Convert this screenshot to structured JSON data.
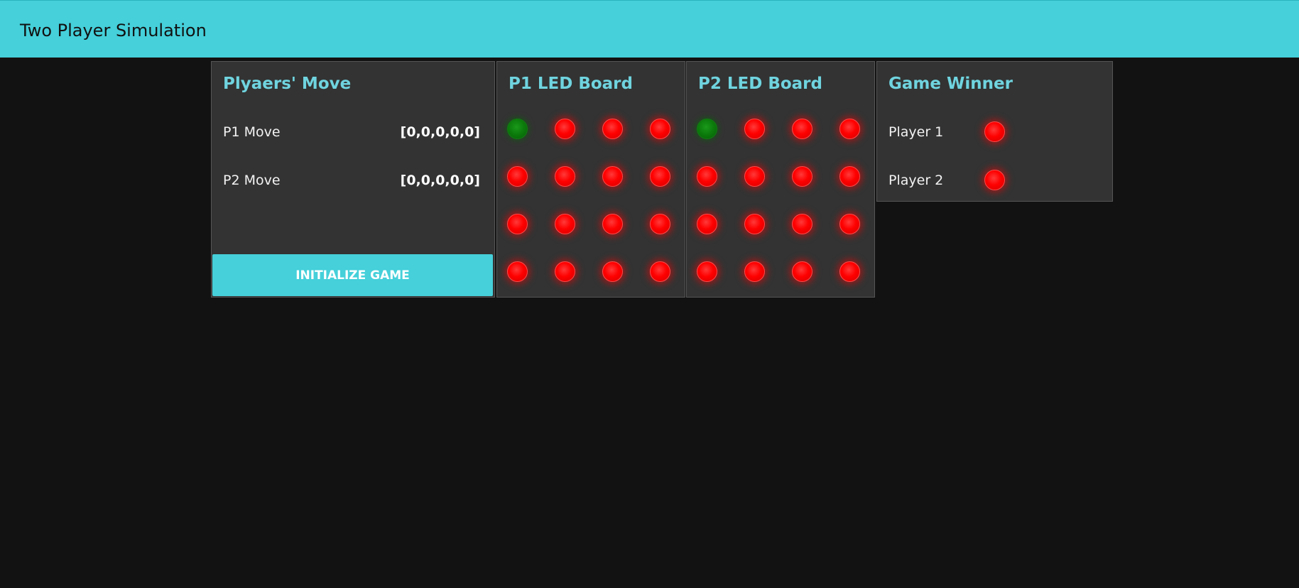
{
  "header": {
    "title": "Two Player Simulation"
  },
  "moves_card": {
    "title": "Plyaers' Move",
    "rows": [
      {
        "label": "P1 Move",
        "value": "[0,0,0,0,0]"
      },
      {
        "label": "P2 Move",
        "value": "[0,0,0,0,0]"
      }
    ],
    "init_button_label": "INITIALIZE GAME"
  },
  "p1_board": {
    "title": "P1 LED Board",
    "leds": [
      [
        "green",
        "red",
        "red",
        "red"
      ],
      [
        "red",
        "red",
        "red",
        "red"
      ],
      [
        "red",
        "red",
        "red",
        "red"
      ],
      [
        "red",
        "red",
        "red",
        "red"
      ]
    ]
  },
  "p2_board": {
    "title": "P2 LED Board",
    "leds": [
      [
        "green",
        "red",
        "red",
        "red"
      ],
      [
        "red",
        "red",
        "red",
        "red"
      ],
      [
        "red",
        "red",
        "red",
        "red"
      ],
      [
        "red",
        "red",
        "red",
        "red"
      ]
    ]
  },
  "winner_card": {
    "title": "Game Winner",
    "rows": [
      {
        "label": "Player 1",
        "led": "red"
      },
      {
        "label": "Player 2",
        "led": "red"
      }
    ]
  },
  "colors": {
    "accent": "#45d0da",
    "title_text": "#6fd4df",
    "background": "#121212",
    "card": "#333333",
    "led_on": "#0b7a0b",
    "led_off": "#ff0000"
  }
}
